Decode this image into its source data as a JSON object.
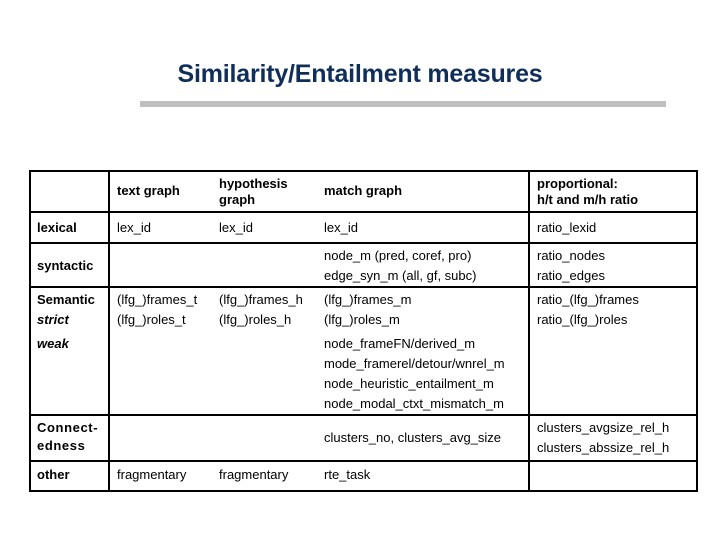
{
  "slide": {
    "title": "Similarity/Entailment measures"
  },
  "table": {
    "headers": [
      "",
      "text graph",
      "hypothesis graph",
      "match graph",
      "proportional: h/t and m/h ratio"
    ],
    "header_lines": {
      "text_graph": "text graph",
      "hypothesis_1": "hypothesis",
      "hypothesis_2": "graph",
      "match_graph": "match graph",
      "proportional_1": "proportional:",
      "proportional_2": "h/t and m/h ratio"
    },
    "rows": {
      "lexical": {
        "label": "lexical",
        "text_graph": "lex_id",
        "hypothesis_graph": "lex_id",
        "match_graph": "lex_id",
        "proportional": "ratio_lexid"
      },
      "syntactic": {
        "label": "syntactic",
        "text_graph": "",
        "hypothesis_graph": "",
        "match_graph": [
          "node_m (pred, coref, pro)",
          "edge_syn_m (all, gf, subc)"
        ],
        "proportional": [
          "ratio_nodes",
          "ratio_edges"
        ]
      },
      "semantic": {
        "label": "Semantic",
        "sub_strict": "strict",
        "sub_weak": "weak",
        "strict": {
          "text_graph": [
            "(lfg_)frames_t",
            "(lfg_)roles_t"
          ],
          "hypothesis_graph": [
            "(lfg_)frames_h",
            "(lfg_)roles_h"
          ],
          "match_graph": [
            "(lfg_)frames_m",
            "(lfg_)roles_m"
          ],
          "proportional": [
            "ratio_(lfg_)frames",
            "ratio_(lfg_)roles"
          ]
        },
        "weak": {
          "match_graph": [
            "node_frameFN/derived_m",
            "mode_framerel/detour/wnrel_m",
            "node_heuristic_entailment_m",
            "node_modal_ctxt_mismatch_m"
          ]
        }
      },
      "connectedness": {
        "label_1": "Connect-",
        "label_2": "edness",
        "match_graph": "clusters_no, clusters_avg_size",
        "proportional": [
          "clusters_avgsize_rel_h",
          "clusters_abssize_rel_h"
        ]
      },
      "other": {
        "label": "other",
        "text_graph": "fragmentary",
        "hypothesis_graph": "fragmentary",
        "match_graph": "rte_task",
        "proportional": ""
      }
    }
  },
  "colors": {
    "title": "#0f2f5a",
    "rule": "#c0c0c0",
    "border": "#000000"
  }
}
